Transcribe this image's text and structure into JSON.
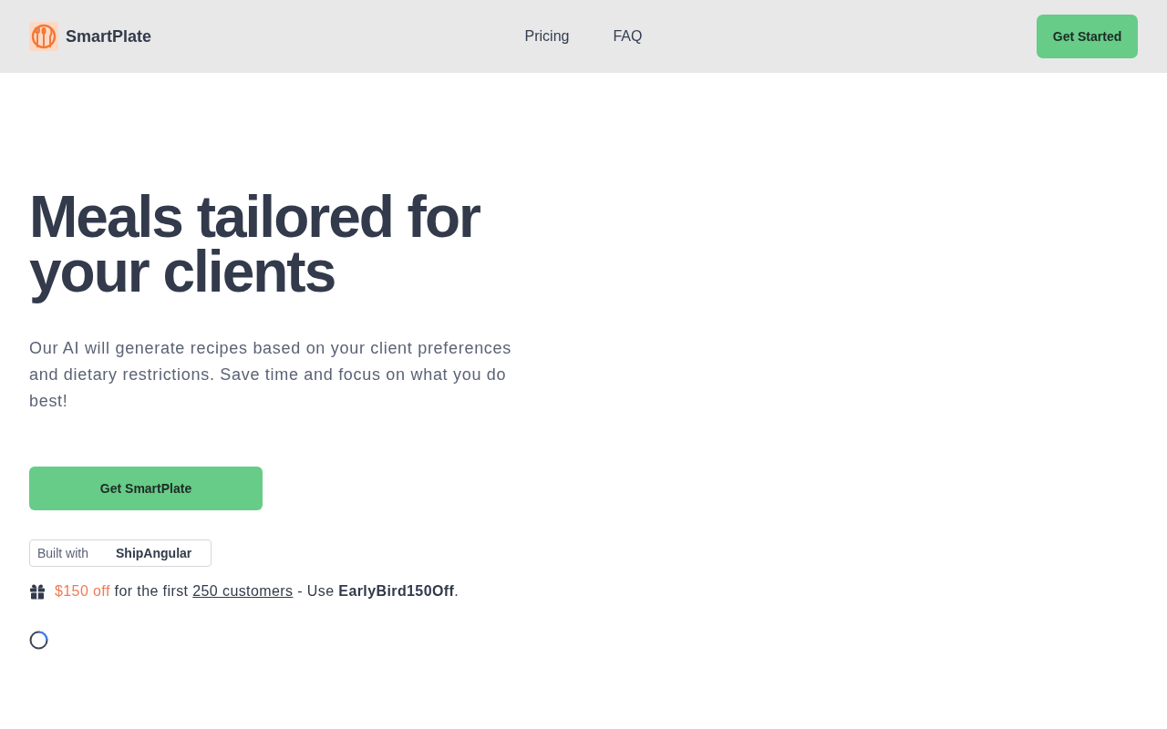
{
  "header": {
    "brand": "SmartPlate",
    "nav": [
      "Pricing",
      "FAQ"
    ],
    "cta": "Get Started"
  },
  "hero": {
    "title": "Meals tailored for your clients",
    "description": "Our AI will generate recipes based on your client preferences and dietary restrictions. Save time and focus on what you do best!",
    "cta": "Get SmartPlate",
    "built_with": {
      "label": "Built with",
      "name": "ShipAngular"
    },
    "offer": {
      "highlight": "$150 off",
      "before_link": "for the first",
      "link": "250 customers",
      "after_link": "- Use **EarlyBird150Off**."
    }
  }
}
